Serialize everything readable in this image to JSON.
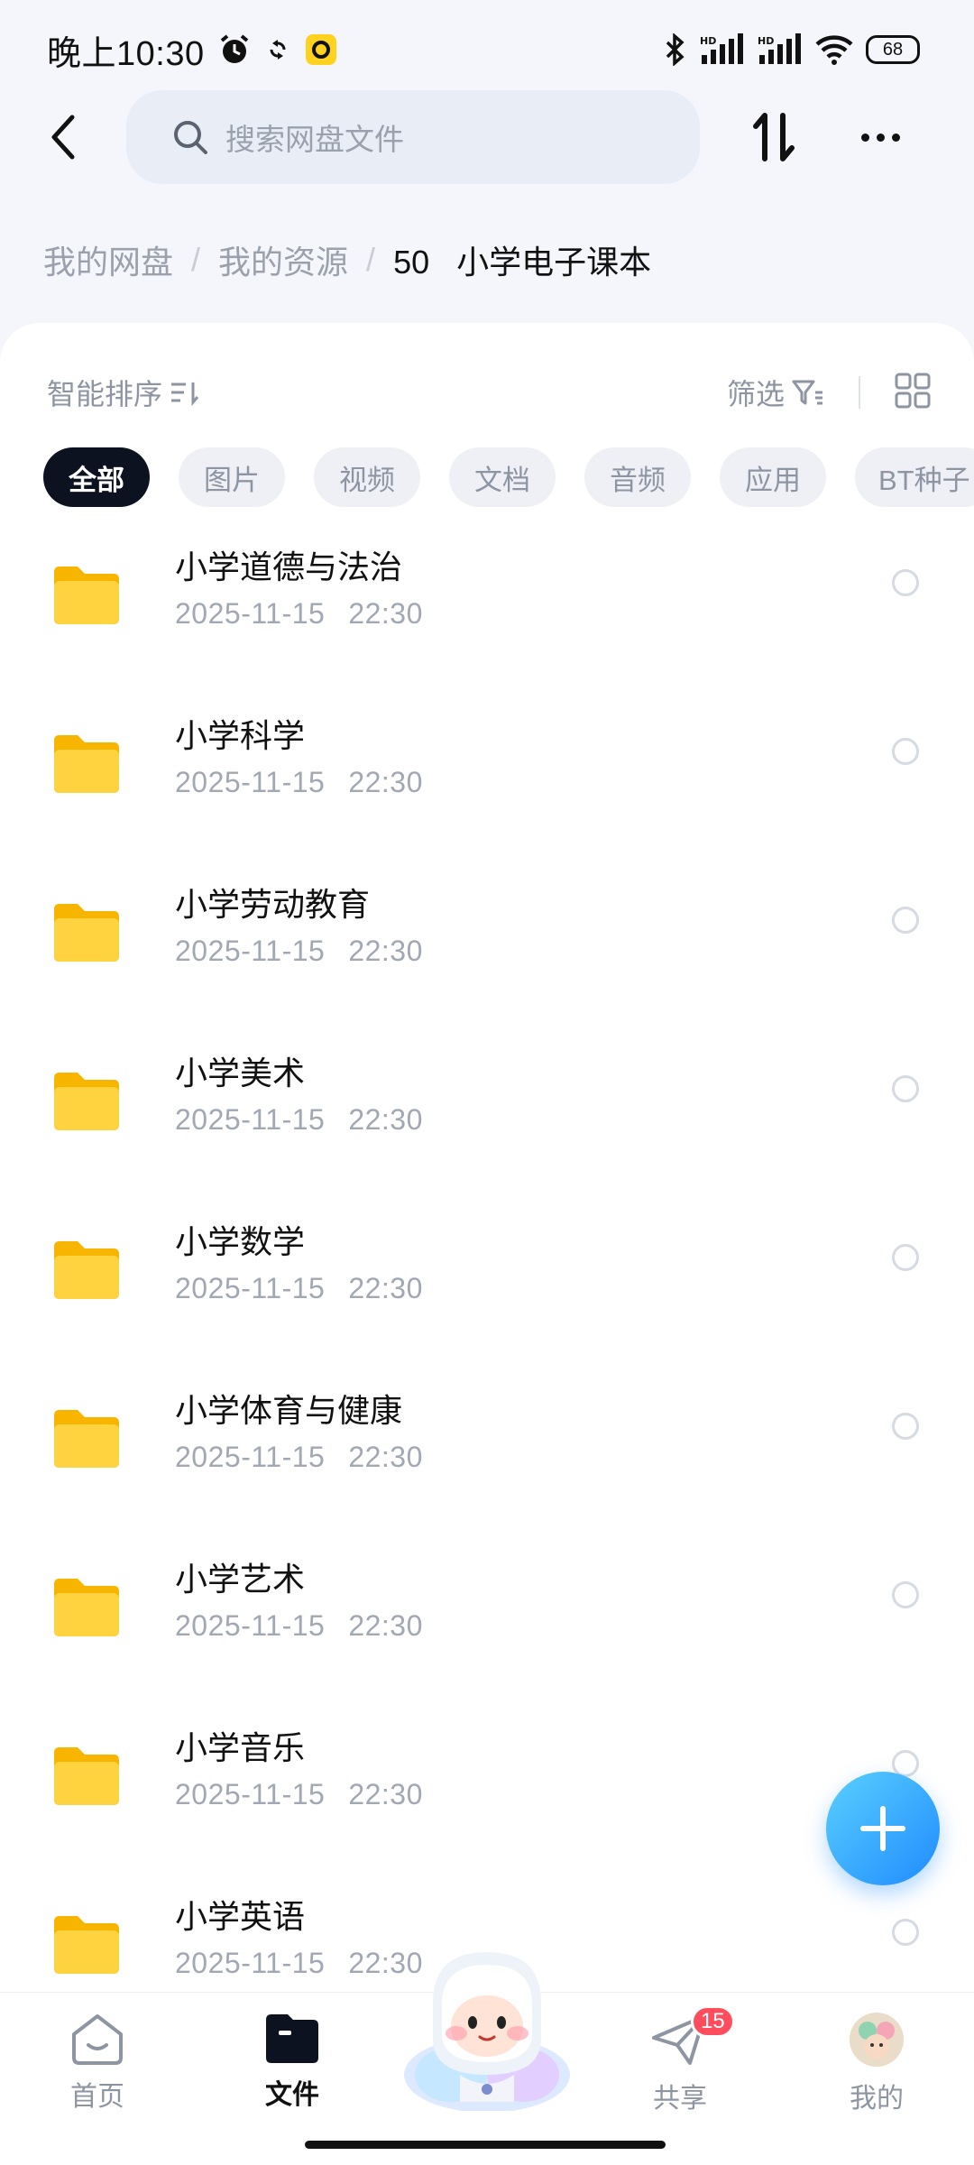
{
  "status_bar": {
    "time": "晚上10:30",
    "battery": "68"
  },
  "header": {
    "search_placeholder": "搜索网盘文件"
  },
  "breadcrumb": {
    "items": [
      "我的网盘",
      "我的资源"
    ],
    "current": "50   小学电子课本"
  },
  "toolbar": {
    "sort_label": "智能排序",
    "filter_label": "筛选"
  },
  "chips": [
    {
      "label": "全部",
      "active": true
    },
    {
      "label": "图片",
      "active": false
    },
    {
      "label": "视频",
      "active": false
    },
    {
      "label": "文档",
      "active": false
    },
    {
      "label": "音频",
      "active": false
    },
    {
      "label": "应用",
      "active": false
    },
    {
      "label": "BT种子",
      "active": false
    }
  ],
  "files": [
    {
      "name": "小学道德与法治",
      "date": "2025-11-15",
      "time": "22:30"
    },
    {
      "name": "小学科学",
      "date": "2025-11-15",
      "time": "22:30"
    },
    {
      "name": "小学劳动教育",
      "date": "2025-11-15",
      "time": "22:30"
    },
    {
      "name": "小学美术",
      "date": "2025-11-15",
      "time": "22:30"
    },
    {
      "name": "小学数学",
      "date": "2025-11-15",
      "time": "22:30"
    },
    {
      "name": "小学体育与健康",
      "date": "2025-11-15",
      "time": "22:30"
    },
    {
      "name": "小学艺术",
      "date": "2025-11-15",
      "time": "22:30"
    },
    {
      "name": "小学音乐",
      "date": "2025-11-15",
      "time": "22:30"
    },
    {
      "name": "小学英语",
      "date": "2025-11-15",
      "time": "22:30"
    }
  ],
  "bottom_nav": {
    "home": "首页",
    "files": "文件",
    "share": "共享",
    "share_badge": "15",
    "mine": "我的"
  },
  "colors": {
    "accent": "#1f8bff",
    "folder": "#ffcc33",
    "badge": "#ff4d5e"
  }
}
